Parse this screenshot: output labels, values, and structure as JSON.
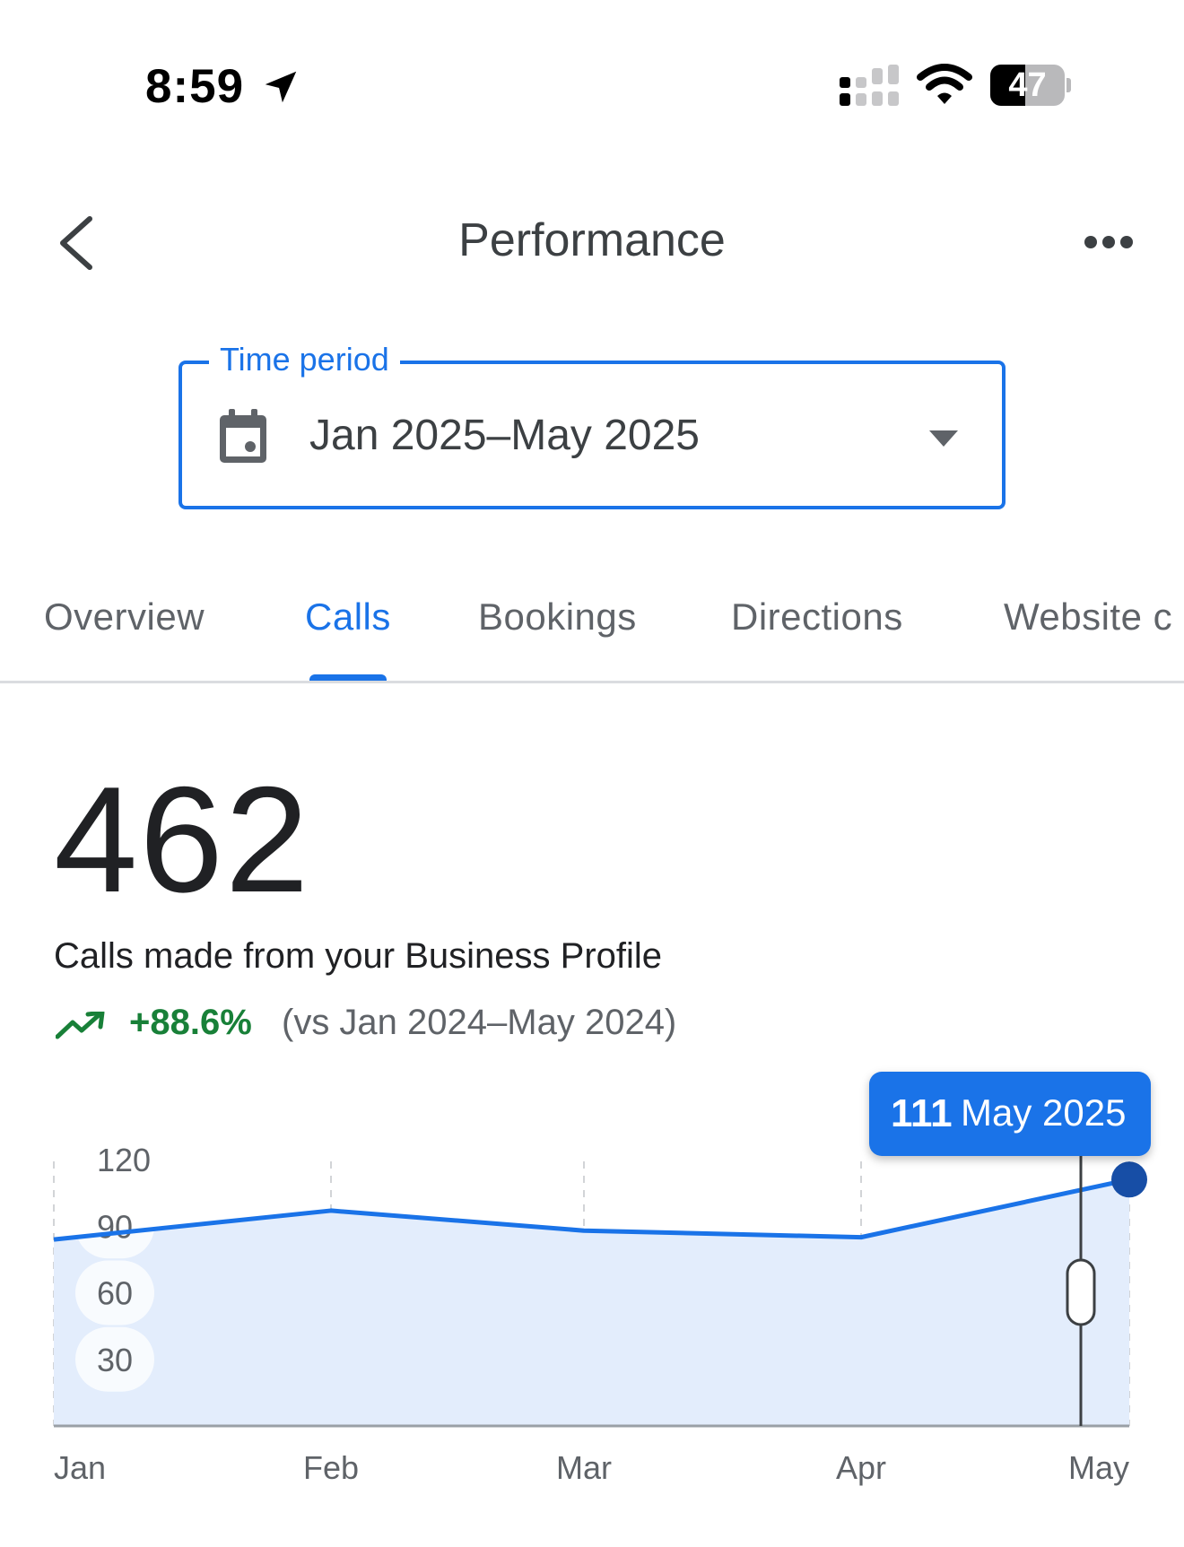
{
  "status_bar": {
    "time": "8:59",
    "battery": "47",
    "battery_level": 0.47,
    "icons": [
      "location-arrow-icon",
      "cellular-signal-icon",
      "wifi-icon",
      "battery-icon"
    ]
  },
  "app_bar": {
    "title": "Performance",
    "icons": [
      "back-arrow-icon",
      "more-horizontal-icon"
    ]
  },
  "time_period": {
    "label": "Time period",
    "value": "Jan 2025–May 2025",
    "icons": [
      "calendar-icon",
      "dropdown-arrow-icon"
    ]
  },
  "tabs": [
    {
      "label": "Overview",
      "active": false
    },
    {
      "label": "Calls",
      "active": true
    },
    {
      "label": "Bookings",
      "active": false
    },
    {
      "label": "Directions",
      "active": false
    },
    {
      "label": "Website c",
      "active": false
    }
  ],
  "metric": {
    "value": "462",
    "description": "Calls made from your Business Profile",
    "change": "+88.6%",
    "comparison": "(vs Jan 2024–May 2024)",
    "trend_icon": "trending-up-icon"
  },
  "colors": {
    "accent": "#1a73e8",
    "positive": "#188038",
    "area_fill": "#e3edfc",
    "selected_point": "#174ea6"
  },
  "tooltip": {
    "value": "111",
    "label": "May 2025"
  },
  "chart_data": {
    "type": "area",
    "categories": [
      "Jan",
      "Feb",
      "Mar",
      "Apr",
      "May"
    ],
    "values": [
      84,
      97,
      88,
      85,
      111
    ],
    "yticks": [
      "120",
      "90",
      "60",
      "30"
    ],
    "ylim": [
      0,
      120
    ],
    "grid": "vertical-dashed",
    "selected_index": 4
  }
}
